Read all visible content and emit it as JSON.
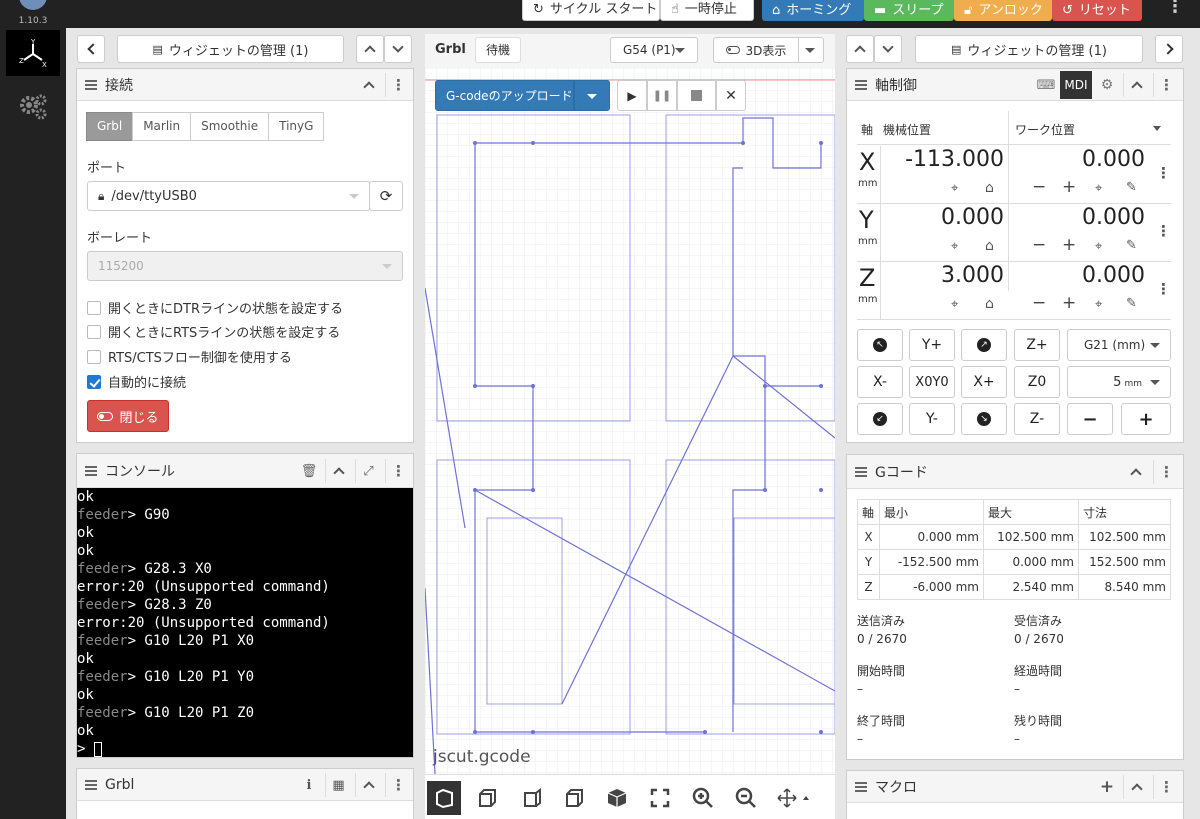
{
  "app": {
    "version": "1.10.3"
  },
  "topbar": {
    "cycle_start": "サイクル スタート",
    "feed_hold": "一時停止",
    "homing": "ホーミング",
    "sleep": "スリープ",
    "unlock": "アンロック",
    "reset": "リセット"
  },
  "colors": {
    "homing": "#337ab7",
    "sleep": "#5cb85c",
    "unlock": "#f0ad4e",
    "reset": "#d9534f",
    "console_bg": "#000000",
    "toolpath": "#8b8fe0"
  },
  "left": {
    "manage_widgets": "ウィジェットの管理 (1)"
  },
  "right": {
    "manage_widgets": "ウィジェットの管理 (1)"
  },
  "connection": {
    "title": "接続",
    "controllers": [
      "Grbl",
      "Marlin",
      "Smoothie",
      "TinyG"
    ],
    "selected_controller": "Grbl",
    "port_label": "ポート",
    "port_value": "/dev/ttyUSB0",
    "baud_label": "ボーレート",
    "baud_value": "115200",
    "options": [
      {
        "label": "開くときにDTRラインの状態を設定する",
        "checked": false
      },
      {
        "label": "開くときにRTSラインの状態を設定する",
        "checked": false
      },
      {
        "label": "RTS/CTSフロー制御を使用する",
        "checked": false
      },
      {
        "label": "自動的に接続",
        "checked": true
      }
    ],
    "close_button": "閉じる"
  },
  "console": {
    "title": "コンソール",
    "lines": [
      {
        "prompt": "",
        "text": "ok"
      },
      {
        "prompt": "feeder",
        "text": "> G90"
      },
      {
        "prompt": "",
        "text": "ok"
      },
      {
        "prompt": "",
        "text": "ok"
      },
      {
        "prompt": "feeder",
        "text": "> G28.3 X0"
      },
      {
        "prompt": "",
        "text": "error:20 (Unsupported command)"
      },
      {
        "prompt": "feeder",
        "text": "> G28.3 Z0"
      },
      {
        "prompt": "",
        "text": "error:20 (Unsupported command)"
      },
      {
        "prompt": "feeder",
        "text": "> G10 L20 P1 X0"
      },
      {
        "prompt": "",
        "text": "ok"
      },
      {
        "prompt": "feeder",
        "text": "> G10 L20 P1 Y0"
      },
      {
        "prompt": "",
        "text": "ok"
      },
      {
        "prompt": "feeder",
        "text": "> G10 L20 P1 Z0"
      },
      {
        "prompt": "",
        "text": "ok"
      },
      {
        "prompt": "",
        "text": "> "
      }
    ]
  },
  "grbl_widget": {
    "title": "Grbl"
  },
  "visualizer": {
    "controller": "Grbl",
    "state": "待機",
    "wcs": "G54 (P1)",
    "view_3d": "3D表示",
    "upload": "G-codeのアップロード",
    "file": "jscut.gcode"
  },
  "axes": {
    "title": "軸制御",
    "mdi": "MDI",
    "col_axis": "軸",
    "col_machine": "機械位置",
    "col_work": "ワーク位置",
    "unit": "mm",
    "rows": [
      {
        "axis": "X",
        "machine": "-113.000",
        "work": "0.000"
      },
      {
        "axis": "Y",
        "machine": "0.000",
        "work": "0.000"
      },
      {
        "axis": "Z",
        "machine": "3.000",
        "work": "0.000"
      }
    ],
    "jog": {
      "y_plus": "Y+",
      "y_minus": "Y-",
      "x_minus": "X-",
      "x_plus": "X+",
      "z_plus": "Z+",
      "z_minus": "Z-",
      "xy_zero": "X0Y0",
      "z_zero": "Z0",
      "minus": "−",
      "plus": "+"
    },
    "plane": "G21 (mm)",
    "step": "5",
    "step_unit": "mm"
  },
  "gcode": {
    "title": "Gコード",
    "headers": [
      "軸",
      "最小",
      "最大",
      "寸法"
    ],
    "rows": [
      [
        "X",
        "0.000 mm",
        "102.500 mm",
        "102.500 mm"
      ],
      [
        "Y",
        "-152.500 mm",
        "0.000 mm",
        "152.500 mm"
      ],
      [
        "Z",
        "-6.000 mm",
        "2.540 mm",
        "8.540 mm"
      ]
    ],
    "sent_label": "送信済み",
    "sent": "0 / 2670",
    "recv_label": "受信済み",
    "recv": "0 / 2670",
    "start_label": "開始時間",
    "start": "–",
    "elapsed_label": "経過時間",
    "elapsed": "–",
    "end_label": "終了時間",
    "end": "–",
    "remain_label": "残り時間",
    "remain": "–"
  },
  "macro": {
    "title": "マクロ"
  }
}
